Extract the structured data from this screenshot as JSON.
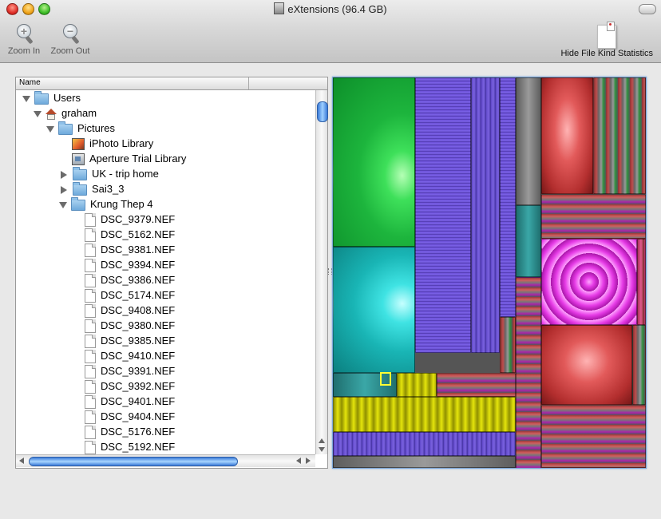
{
  "window": {
    "title": "eXtensions (96.4 GB)"
  },
  "toolbar": {
    "zoom_in": "Zoom In",
    "zoom_out": "Zoom Out",
    "hide_stats": "Hide File Kind Statistics"
  },
  "outline": {
    "column_name": "Name",
    "rows": [
      {
        "label": "Users",
        "icon": "folder-icon",
        "expander": "down"
      },
      {
        "label": "graham",
        "icon": "home-icon",
        "expander": "down"
      },
      {
        "label": "Pictures",
        "icon": "folder-icon",
        "expander": "down"
      },
      {
        "label": "iPhoto Library",
        "icon": "iphoto-icon",
        "expander": "none"
      },
      {
        "label": "Aperture Trial Library",
        "icon": "aperture-icon",
        "expander": "none"
      },
      {
        "label": "UK - trip home",
        "icon": "folder-icon",
        "expander": "right"
      },
      {
        "label": "Sai3_3",
        "icon": "folder-icon",
        "expander": "right"
      },
      {
        "label": "Krung Thep 4",
        "icon": "folder-icon",
        "expander": "down"
      },
      {
        "label": "DSC_9379.NEF",
        "icon": "file-icon",
        "expander": "none"
      },
      {
        "label": "DSC_5162.NEF",
        "icon": "file-icon",
        "expander": "none"
      },
      {
        "label": "DSC_9381.NEF",
        "icon": "file-icon",
        "expander": "none"
      },
      {
        "label": "DSC_9394.NEF",
        "icon": "file-icon",
        "expander": "none"
      },
      {
        "label": "DSC_9386.NEF",
        "icon": "file-icon",
        "expander": "none"
      },
      {
        "label": "DSC_5174.NEF",
        "icon": "file-icon",
        "expander": "none"
      },
      {
        "label": "DSC_9408.NEF",
        "icon": "file-icon",
        "expander": "none"
      },
      {
        "label": "DSC_9380.NEF",
        "icon": "file-icon",
        "expander": "none"
      },
      {
        "label": "DSC_9385.NEF",
        "icon": "file-icon",
        "expander": "none"
      },
      {
        "label": "DSC_9410.NEF",
        "icon": "file-icon",
        "expander": "none"
      },
      {
        "label": "DSC_9391.NEF",
        "icon": "file-icon",
        "expander": "none"
      },
      {
        "label": "DSC_9392.NEF",
        "icon": "file-icon",
        "expander": "none"
      },
      {
        "label": "DSC_9401.NEF",
        "icon": "file-icon",
        "expander": "none"
      },
      {
        "label": "DSC_9404.NEF",
        "icon": "file-icon",
        "expander": "none"
      },
      {
        "label": "DSC_5176.NEF",
        "icon": "file-icon",
        "expander": "none"
      },
      {
        "label": "DSC_5192.NEF",
        "icon": "file-icon",
        "expander": "none"
      }
    ]
  },
  "treemap": {
    "legend_colors": {
      "green": "#1db53d",
      "cyan": "#19b5b5",
      "purple": "#6a4fd6",
      "red": "#e25a5a",
      "magenta": "#e63be6",
      "yellow": "#e5e50c",
      "gray": "#8a8a8a"
    }
  }
}
